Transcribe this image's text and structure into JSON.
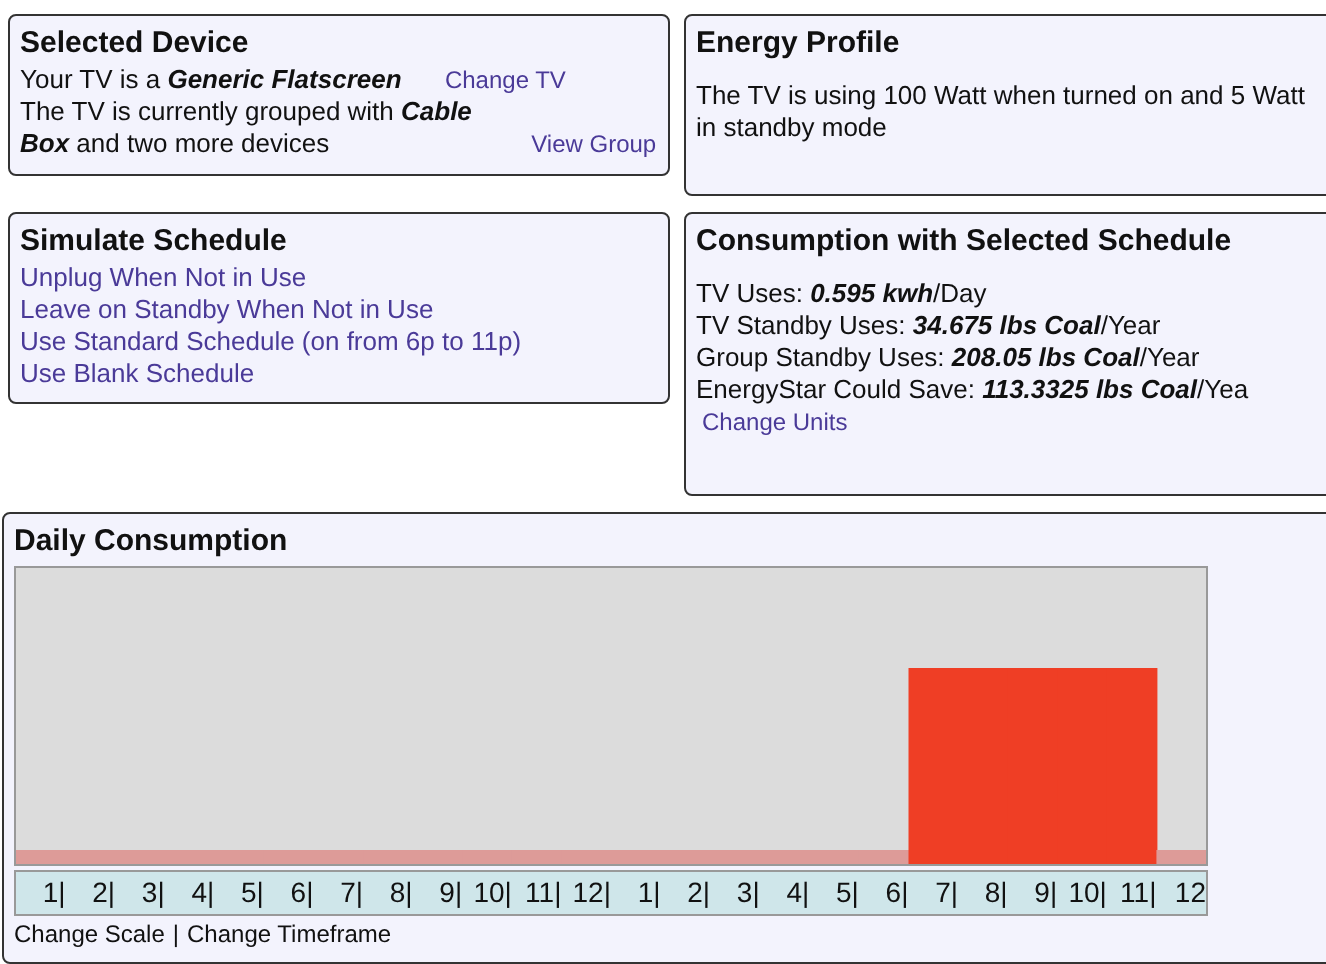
{
  "selected_device": {
    "title": "Selected Device",
    "lines": [
      {
        "before": "Your TV is a ",
        "emphasis": "Generic Flatscreen",
        "link": "Change TV"
      },
      {
        "before": "The TV is currently grouped with ",
        "emphasis": "Cable Box",
        "after": " and two more devices",
        "link": "View Group"
      }
    ]
  },
  "energy_profile": {
    "title": "Energy Profile",
    "text": "The TV is using 100 Watt when turned on and 5 Watt in standby mode"
  },
  "simulate_schedule": {
    "title": "Simulate Schedule",
    "links": [
      "Unplug When Not in Use",
      "Leave on Standby When Not in Use",
      "Use Standard Schedule (on from 6p to 11p)",
      "Use Blank Schedule"
    ]
  },
  "consumption": {
    "title": "Consumption with Selected Schedule",
    "lines": [
      {
        "label": "TV Uses: ",
        "value": "0.595 kwh",
        "unit": "/Day"
      },
      {
        "label": "TV Standby Uses: ",
        "value": "34.675 lbs Coal",
        "unit": "/Year"
      },
      {
        "label": "Group Standby Uses: ",
        "value": "208.05 lbs Coal",
        "unit": "/Year"
      },
      {
        "label": "EnergyStar Could Save: ",
        "value": "113.3325 lbs Coal",
        "unit": "/Yea"
      }
    ],
    "link": "Change Units"
  },
  "daily_consumption": {
    "title": "Daily Consumption",
    "hours": [
      {
        "label": "1|",
        "on": false
      },
      {
        "label": "2|",
        "on": false
      },
      {
        "label": "3|",
        "on": false
      },
      {
        "label": "4|",
        "on": false
      },
      {
        "label": "5|",
        "on": false
      },
      {
        "label": "6|",
        "on": false
      },
      {
        "label": "7|",
        "on": false
      },
      {
        "label": "8|",
        "on": false
      },
      {
        "label": "9|",
        "on": false
      },
      {
        "label": "10|",
        "on": false
      },
      {
        "label": "11|",
        "on": false
      },
      {
        "label": "12|",
        "on": false
      },
      {
        "label": "1|",
        "on": false
      },
      {
        "label": "2|",
        "on": false
      },
      {
        "label": "3|",
        "on": false
      },
      {
        "label": "4|",
        "on": false
      },
      {
        "label": "5|",
        "on": false
      },
      {
        "label": "6|",
        "on": false
      },
      {
        "label": "7|",
        "on": true
      },
      {
        "label": "8|",
        "on": true
      },
      {
        "label": "9|",
        "on": true
      },
      {
        "label": "10|",
        "on": true
      },
      {
        "label": "11|",
        "on": true
      },
      {
        "label": "12",
        "on": false
      }
    ],
    "links": [
      "Change Scale",
      "Change Timeframe"
    ],
    "separator": "|"
  }
}
